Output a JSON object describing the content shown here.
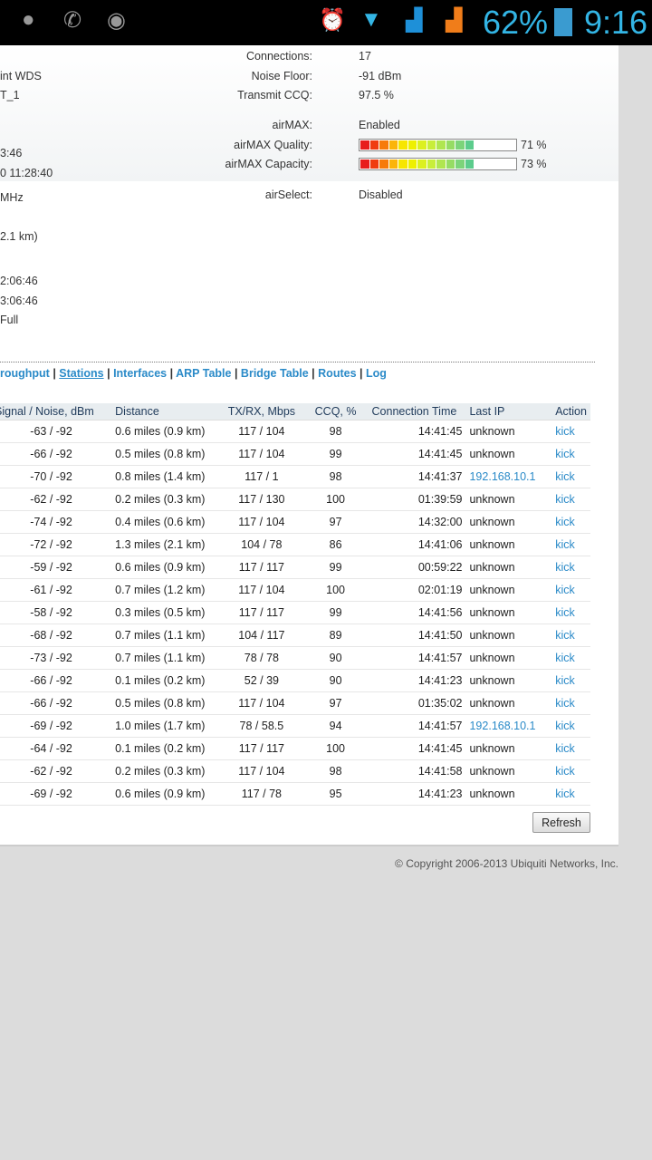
{
  "statusbar": {
    "battery": "62%",
    "time": "9:16"
  },
  "left_fragments": [
    "int WDS",
    "T_1",
    "3:46",
    "0 11:28:40",
    "MHz",
    "2.1 km)",
    "2:06:46",
    "3:06:46",
    "Full"
  ],
  "info": {
    "connections_label": "Connections:",
    "connections": "17",
    "noise_label": "Noise Floor:",
    "noise": "-91 dBm",
    "ccq_label": "Transmit CCQ:",
    "ccq": "97.5 %",
    "airmax_label": "airMAX:",
    "airmax": "Enabled",
    "quality_label": "airMAX Quality:",
    "quality": "71 %",
    "quality_value": 71,
    "capacity_label": "airMAX Capacity:",
    "capacity": "73 %",
    "capacity_value": 73,
    "airselect_label": "airSelect:",
    "airselect": "Disabled"
  },
  "nav": {
    "items": [
      "roughput",
      "Stations",
      "Interfaces",
      "ARP Table",
      "Bridge Table",
      "Routes",
      "Log"
    ],
    "active": "Stations"
  },
  "table": {
    "headers": [
      "Signal / Noise, dBm",
      "Distance",
      "TX/RX, Mbps",
      "CCQ, %",
      "Connection Time",
      "Last IP",
      "Action"
    ],
    "rows": [
      [
        "-63 / -92",
        "0.6 miles (0.9 km)",
        "117 / 104",
        "98",
        "14:41:45",
        "unknown",
        "kick"
      ],
      [
        "-66 / -92",
        "0.5 miles (0.8 km)",
        "117 / 104",
        "99",
        "14:41:45",
        "unknown",
        "kick"
      ],
      [
        "-70 / -92",
        "0.8 miles (1.4 km)",
        "117 / 1",
        "98",
        "14:41:37",
        "192.168.10.1",
        "kick"
      ],
      [
        "-62 / -92",
        "0.2 miles (0.3 km)",
        "117 / 130",
        "100",
        "01:39:59",
        "unknown",
        "kick"
      ],
      [
        "-74 / -92",
        "0.4 miles (0.6 km)",
        "117 / 104",
        "97",
        "14:32:00",
        "unknown",
        "kick"
      ],
      [
        "-72 / -92",
        "1.3 miles (2.1 km)",
        "104 / 78",
        "86",
        "14:41:06",
        "unknown",
        "kick"
      ],
      [
        "-59 / -92",
        "0.6 miles (0.9 km)",
        "117 / 117",
        "99",
        "00:59:22",
        "unknown",
        "kick"
      ],
      [
        "-61 / -92",
        "0.7 miles (1.2 km)",
        "117 / 104",
        "100",
        "02:01:19",
        "unknown",
        "kick"
      ],
      [
        "-58 / -92",
        "0.3 miles (0.5 km)",
        "117 / 117",
        "99",
        "14:41:56",
        "unknown",
        "kick"
      ],
      [
        "-68 / -92",
        "0.7 miles (1.1 km)",
        "104 / 117",
        "89",
        "14:41:50",
        "unknown",
        "kick"
      ],
      [
        "-73 / -92",
        "0.7 miles (1.1 km)",
        "78 / 78",
        "90",
        "14:41:57",
        "unknown",
        "kick"
      ],
      [
        "-66 / -92",
        "0.1 miles (0.2 km)",
        "52 / 39",
        "90",
        "14:41:23",
        "unknown",
        "kick"
      ],
      [
        "-66 / -92",
        "0.5 miles (0.8 km)",
        "117 / 104",
        "97",
        "01:35:02",
        "unknown",
        "kick"
      ],
      [
        "-69 / -92",
        "1.0 miles (1.7 km)",
        "78 / 58.5",
        "94",
        "14:41:57",
        "192.168.10.1",
        "kick"
      ],
      [
        "-64 / -92",
        "0.1 miles (0.2 km)",
        "117 / 117",
        "100",
        "14:41:45",
        "unknown",
        "kick"
      ],
      [
        "-62 / -92",
        "0.2 miles (0.3 km)",
        "117 / 104",
        "98",
        "14:41:58",
        "unknown",
        "kick"
      ],
      [
        "-69 / -92",
        "0.6 miles (0.9 km)",
        "117 / 78",
        "95",
        "14:41:23",
        "unknown",
        "kick"
      ]
    ]
  },
  "refresh_label": "Refresh",
  "copyright": "© Copyright 2006-2013 Ubiquiti Networks, Inc."
}
